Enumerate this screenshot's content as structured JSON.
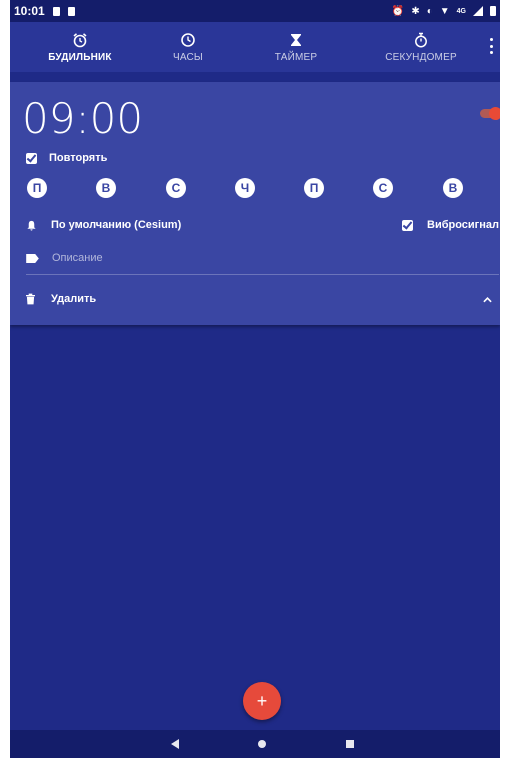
{
  "status_bar": {
    "time": "10:01",
    "icons": [
      "alarm-icon",
      "bluetooth-icon",
      "data-saver-icon",
      "wifi-icon",
      "signal-icon",
      "battery-icon"
    ],
    "network": "4G"
  },
  "tabs": [
    {
      "label": "БУДИЛЬНИК",
      "icon": "alarm-clock-icon",
      "active": true
    },
    {
      "label": "ЧАСЫ",
      "icon": "clock-icon",
      "active": false
    },
    {
      "label": "ТАЙМЕР",
      "icon": "hourglass-icon",
      "active": false
    },
    {
      "label": "СЕКУНДОМЕР",
      "icon": "stopwatch-icon",
      "active": false
    }
  ],
  "alarm": {
    "time": "09:00",
    "enabled": true,
    "repeat_label": "Повторять",
    "repeat_checked": true,
    "days": [
      "П",
      "В",
      "С",
      "Ч",
      "П",
      "С",
      "В"
    ],
    "ringtone": "По умолчанию (Cesium)",
    "vibrate_label": "Вибросигнал",
    "vibrate_checked": true,
    "description_placeholder": "Описание",
    "delete_label": "Удалить"
  },
  "fab_label": "+",
  "colors": {
    "background": "#1f2a87",
    "card": "#3a46a3",
    "accent": "#e64a3b",
    "status_bar": "#141d6a"
  }
}
